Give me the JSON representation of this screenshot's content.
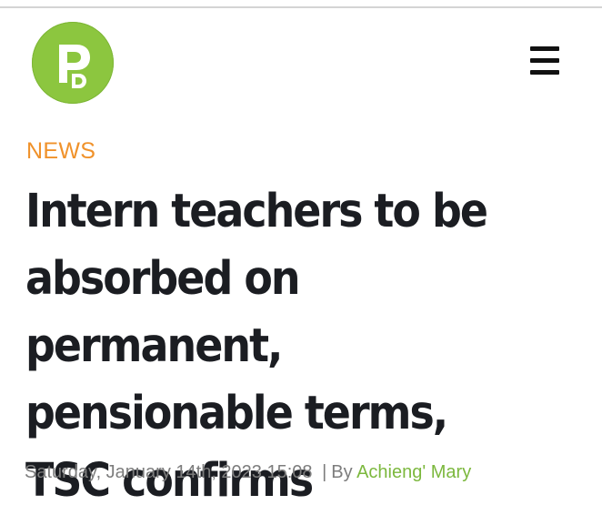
{
  "header": {
    "logo_alt": "PD",
    "menu_icon": "hamburger-menu-icon"
  },
  "article": {
    "category": "NEWS",
    "headline": "Intern teachers to be absorbed on permanent, pensionable terms, TSC confirms",
    "date": "Saturday, January 14th, 2023 15:08",
    "separator": "|",
    "by_label": "By",
    "author": "Achieng' Mary"
  },
  "colors": {
    "logo_green": "#8cc63f",
    "category_orange": "#f0922b",
    "author_green": "#7cb83e",
    "headline": "#1b1d22",
    "meta_gray": "#7d7d7d"
  }
}
